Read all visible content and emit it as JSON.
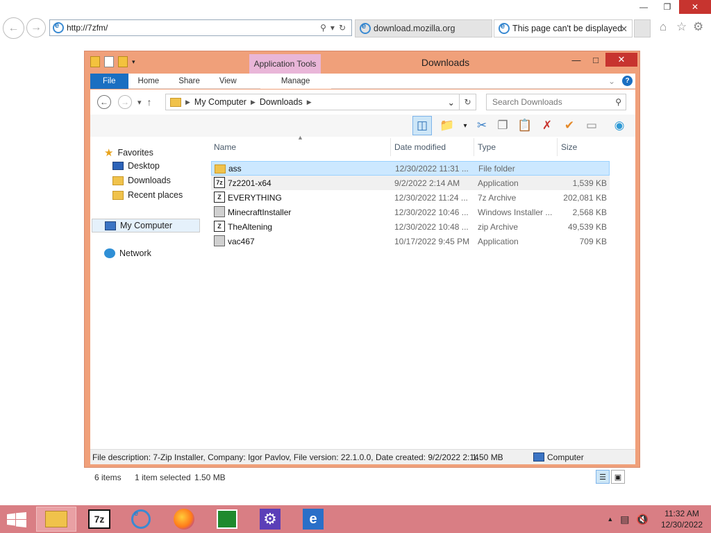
{
  "browser": {
    "address": "http://7zfm/",
    "tabs": [
      {
        "label": "download.mozilla.org"
      },
      {
        "label": "This page can't be displayed"
      }
    ]
  },
  "explorer": {
    "window_title": "Downloads",
    "app_tools": "Application Tools",
    "ribbon_tabs": [
      "File",
      "Home",
      "Share",
      "View",
      "Manage"
    ],
    "breadcrumb": [
      "My Computer",
      "Downloads"
    ],
    "search_placeholder": "Search Downloads",
    "columns": [
      "Name",
      "Date modified",
      "Type",
      "Size"
    ],
    "sidebar": {
      "favorites": "Favorites",
      "favorites_items": [
        "Desktop",
        "Downloads",
        "Recent places"
      ],
      "computer": "My Computer",
      "network": "Network"
    },
    "files": [
      {
        "name": "ass",
        "date": "12/30/2022 11:31 ...",
        "type": "File folder",
        "size": "",
        "icon": "folder"
      },
      {
        "name": "7z2201-x64",
        "date": "9/2/2022 2:14 AM",
        "type": "Application",
        "size": "1,539 KB",
        "icon": "7z-app"
      },
      {
        "name": "EVERYTHING",
        "date": "12/30/2022 11:24 ...",
        "type": "7z Archive",
        "size": "202,081 KB",
        "icon": "7z-archive"
      },
      {
        "name": "MinecraftInstaller",
        "date": "12/30/2022 10:46 ...",
        "type": "Windows Installer ...",
        "size": "2,568 KB",
        "icon": "msi"
      },
      {
        "name": "TheAltening",
        "date": "12/30/2022 10:48 ...",
        "type": "zip Archive",
        "size": "49,539 KB",
        "icon": "zip-archive"
      },
      {
        "name": "vac467",
        "date": "10/17/2022 9:45 PM",
        "type": "Application",
        "size": "709 KB",
        "icon": "app"
      }
    ],
    "status": {
      "items": "6 items",
      "selected": "1 item selected",
      "selected_size": "1.50 MB"
    },
    "details": {
      "description": "File description: 7-Zip Installer, Company: Igor Pavlov, File version: 22.1.0.0, Date created: 9/2/2022 2:14",
      "size": "1.50 MB",
      "location": "Computer"
    }
  },
  "taskbar": {
    "apps": [
      "file-explorer",
      "7-zip",
      "internet-explorer",
      "firefox",
      "store",
      "settings",
      "internet-explorer"
    ],
    "time": "11:32 AM",
    "date": "12/30/2022"
  }
}
